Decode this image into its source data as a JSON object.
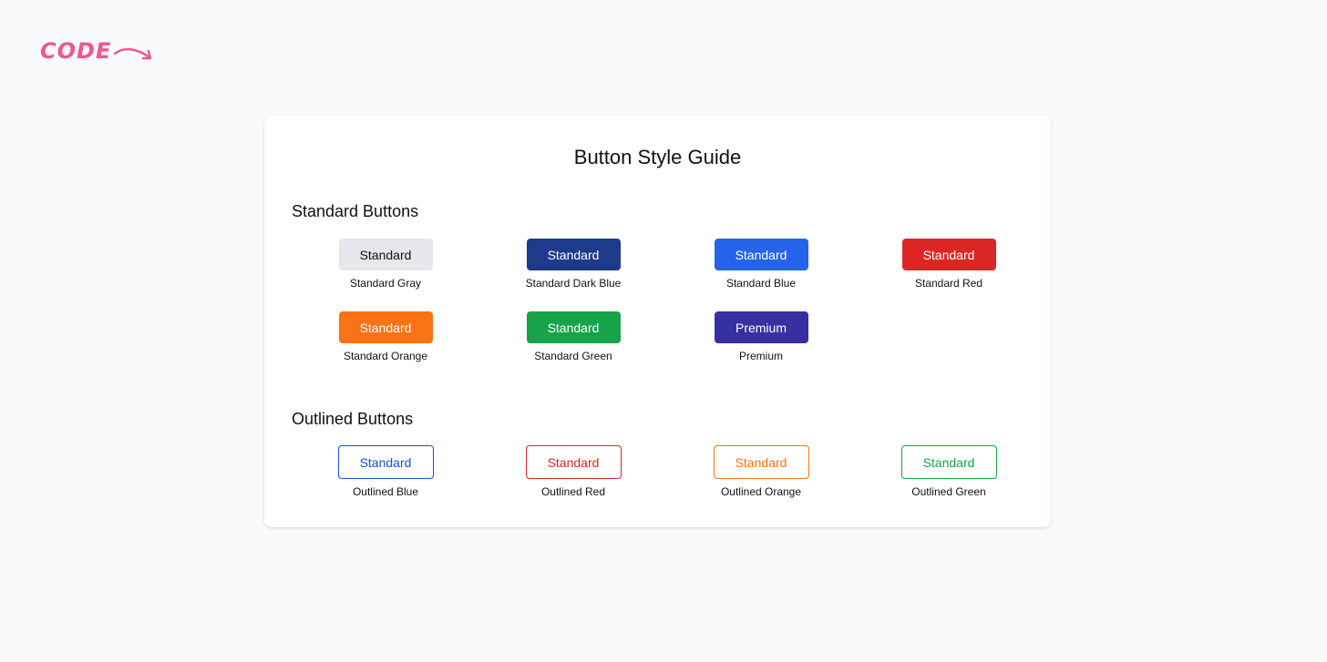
{
  "logo": {
    "text": "CODE",
    "color": "#f0568f"
  },
  "card": {
    "title": "Button Style Guide",
    "standard_section": {
      "title": "Standard Buttons",
      "buttons": [
        {
          "label": "Standard",
          "caption": "Standard Gray",
          "bg": "#e5e7eb",
          "fg": "#111111",
          "border": "#e5e7eb"
        },
        {
          "label": "Standard",
          "caption": "Standard Dark Blue",
          "bg": "#1e3a8a",
          "fg": "#ffffff",
          "border": "#1e3a8a"
        },
        {
          "label": "Standard",
          "caption": "Standard Blue",
          "bg": "#2563eb",
          "fg": "#ffffff",
          "border": "#2563eb"
        },
        {
          "label": "Standard",
          "caption": "Standard Red",
          "bg": "#dc2626",
          "fg": "#ffffff",
          "border": "#dc2626"
        },
        {
          "label": "Standard",
          "caption": "Standard Orange",
          "bg": "#f97316",
          "fg": "#ffffff",
          "border": "#f97316"
        },
        {
          "label": "Standard",
          "caption": "Standard Green",
          "bg": "#16a34a",
          "fg": "#ffffff",
          "border": "#16a34a"
        },
        {
          "label": "Premium",
          "caption": "Premium",
          "bg": "#3730a3",
          "fg": "#ffffff",
          "border": "#3730a3"
        }
      ]
    },
    "outlined_section": {
      "title": "Outlined Buttons",
      "buttons": [
        {
          "label": "Standard",
          "caption": "Outlined Blue",
          "color": "#1d4ed8"
        },
        {
          "label": "Standard",
          "caption": "Outlined Red",
          "color": "#dc2626"
        },
        {
          "label": "Standard",
          "caption": "Outlined Orange",
          "color": "#f97316"
        },
        {
          "label": "Standard",
          "caption": "Outlined Green",
          "color": "#16a34a"
        }
      ]
    }
  }
}
